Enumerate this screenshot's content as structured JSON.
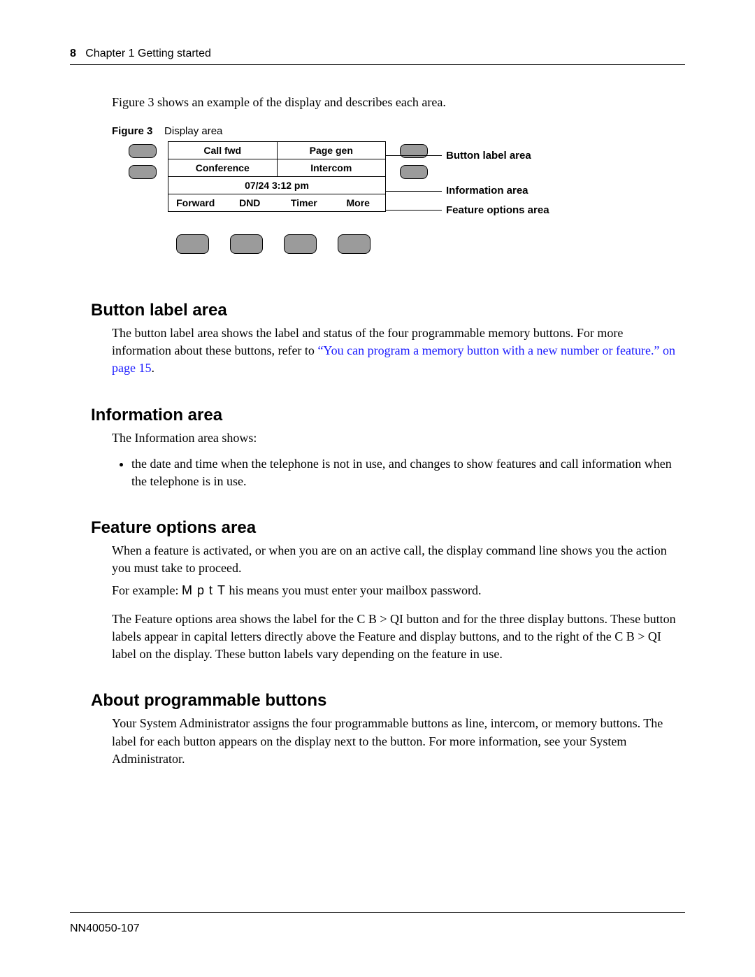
{
  "header": {
    "page_number": "8",
    "chapter": "Chapter 1  Getting started"
  },
  "intro": "Figure 3 shows an example of the display and describes each area.",
  "figure": {
    "number": "Figure 3",
    "caption": "Display area",
    "labels": {
      "call_fwd": "Call fwd",
      "page_gen": "Page gen",
      "conference": "Conference",
      "intercom": "Intercom",
      "datetime": "07/24 3:12 pm",
      "forward": "Forward",
      "dnd": "DND",
      "timer": "Timer",
      "more": "More"
    },
    "annotations": {
      "button_label": "Button label area",
      "info_area": "Information area",
      "feature_options": "Feature options area"
    }
  },
  "sections": {
    "button_label": {
      "title": "Button label area",
      "para": "The button label area shows the label and status of the four programmable memory buttons. For more information about these buttons, refer to ",
      "link": "“You can program a memory button with a new number or feature.” on page 15",
      "after_link": "."
    },
    "info_area": {
      "title": "Information area",
      "intro": "The Information area shows:",
      "bullet": "the date and time when the telephone is not in use, and changes to show features and call information when the telephone is in use."
    },
    "feature_options": {
      "title": "Feature options area",
      "p1a": "When a feature is activated, or when you are on an active call, the display command line shows you the action you must take to proceed.",
      "p1b_prefix": "For example: ",
      "p1b_code": "M p t T",
      "p1b_suffix": "his means you must enter your mailbox password.",
      "p2": "The Feature options area shows the label for the  C B > QI button and for the three display buttons. These button labels appear in capital letters directly above the Feature and display buttons, and to the right of the  C B > QI label on the display. These button labels vary depending on the feature in use."
    },
    "about_buttons": {
      "title": "About programmable buttons",
      "para": "Your System Administrator assigns the four programmable buttons as line, intercom, or memory buttons. The label for each button appears on the display next to the button. For more information, see your System Administrator."
    }
  },
  "footer": "NN40050-107"
}
